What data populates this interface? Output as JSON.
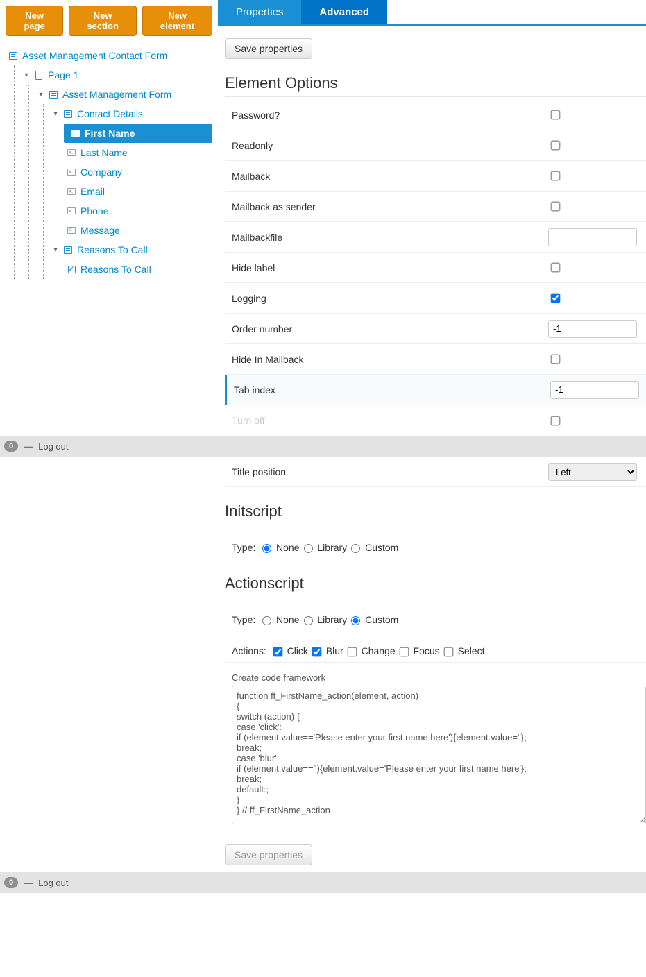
{
  "toolbar": {
    "new_page": "New page",
    "new_section": "New section",
    "new_element": "New element"
  },
  "tree": {
    "root": "Asset Management Contact Form",
    "page": "Page 1",
    "form": "Asset Management Form",
    "section1": "Contact Details",
    "fields": [
      "First Name",
      "Last Name",
      "Company",
      "Email",
      "Phone",
      "Message"
    ],
    "section2": "Reasons To Call",
    "checkbox_field": "Reasons To Call"
  },
  "tabs": {
    "properties": "Properties",
    "advanced": "Advanced"
  },
  "save_btn": "Save properties",
  "sections": {
    "element_options": "Element Options",
    "initscript": "Initscript",
    "actionscript": "Actionscript"
  },
  "options": [
    {
      "label": "Password?",
      "type": "checkbox",
      "checked": false
    },
    {
      "label": "Readonly",
      "type": "checkbox",
      "checked": false
    },
    {
      "label": "Mailback",
      "type": "checkbox",
      "checked": false
    },
    {
      "label": "Mailback as sender",
      "type": "checkbox",
      "checked": false
    },
    {
      "label": "Mailbackfile",
      "type": "text",
      "value": ""
    },
    {
      "label": "Hide label",
      "type": "checkbox",
      "checked": false
    },
    {
      "label": "Logging",
      "type": "checkbox",
      "checked": true
    },
    {
      "label": "Order number",
      "type": "text",
      "value": "-1"
    },
    {
      "label": "Hide In Mailback",
      "type": "checkbox",
      "checked": false
    },
    {
      "label": "Tab index",
      "type": "text",
      "value": "-1",
      "highlight": true
    },
    {
      "label": "Turn off",
      "type": "checkbox",
      "checked": false,
      "faded": true
    },
    {
      "label": "Title position",
      "type": "select",
      "value": "Left"
    }
  ],
  "script_type_label": "Type:",
  "script_type_options": [
    "None",
    "Library",
    "Custom"
  ],
  "initscript_selected": "None",
  "actionscript_selected": "Custom",
  "actions_label": "Actions:",
  "actions": [
    {
      "label": "Click",
      "checked": true
    },
    {
      "label": "Blur",
      "checked": true
    },
    {
      "label": "Change",
      "checked": false
    },
    {
      "label": "Focus",
      "checked": false
    },
    {
      "label": "Select",
      "checked": false
    }
  ],
  "code_framework_label": "Create code framework",
  "code": "function ff_FirstName_action(element, action)\n{\nswitch (action) {\ncase 'click':\nif (element.value=='Please enter your first name here'){element.value=''};\nbreak;\ncase 'blur':\nif (element.value==''){element.value='Please enter your first name here'};\nbreak;\ndefault:;\n}\n} // ff_FirstName_action",
  "footer": {
    "count": "0",
    "logout": "Log out"
  }
}
